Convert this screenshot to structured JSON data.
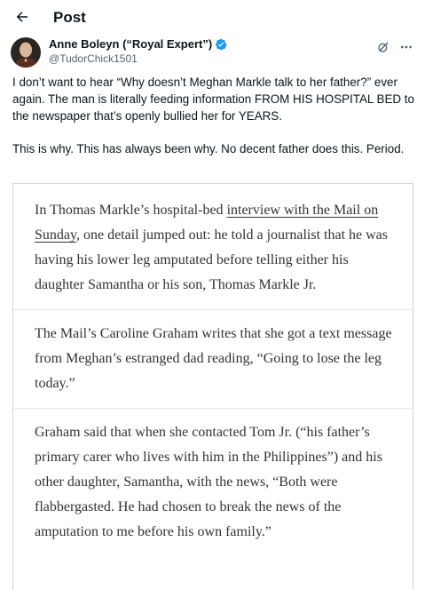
{
  "header": {
    "title": "Post"
  },
  "post": {
    "author": {
      "display_name": "Anne Boleyn (“Royal Expert”)",
      "handle": "@TudorChick1501",
      "verified": true
    },
    "text_paragraphs": [
      "I don’t want to hear “Why doesn’t Meghan Markle talk to her father?” ever again. The man is literally feeding information FROM HIS HOSPITAL BED to the newspaper that’s openly bullied her for YEARS.",
      "This is why. This has always been why. No decent father does this. Period."
    ]
  },
  "article_image": {
    "p1_before": "In Thomas Markle’s hospital-bed ",
    "p1_link": "interview with the Mail on Sunday",
    "p1_after": ", one detail jumped out: he told a journalist that he was having his lower leg amputated before telling either his daughter Samantha or his son, Thomas Markle Jr.",
    "p2": "The Mail’s Caroline Graham writes that she got a text message from Meghan’s estranged dad reading, “Going to lose the leg today.”",
    "p3": "Graham said that when she contacted Tom Jr. (“his father’s primary carer who lives with him in the Philippines”) and his other daughter, Samantha, with the news, “Both were flabbergasted. He had chosen to break the news of the amputation to me before his own family.”"
  },
  "colors": {
    "verified_badge": "#1d9bf0",
    "secondary_text": "#536471",
    "border": "#cfd9de"
  },
  "icons": {
    "back": "arrow-left-icon",
    "verified": "verified-badge-icon",
    "grok": "grok-icon",
    "more": "more-icon"
  }
}
